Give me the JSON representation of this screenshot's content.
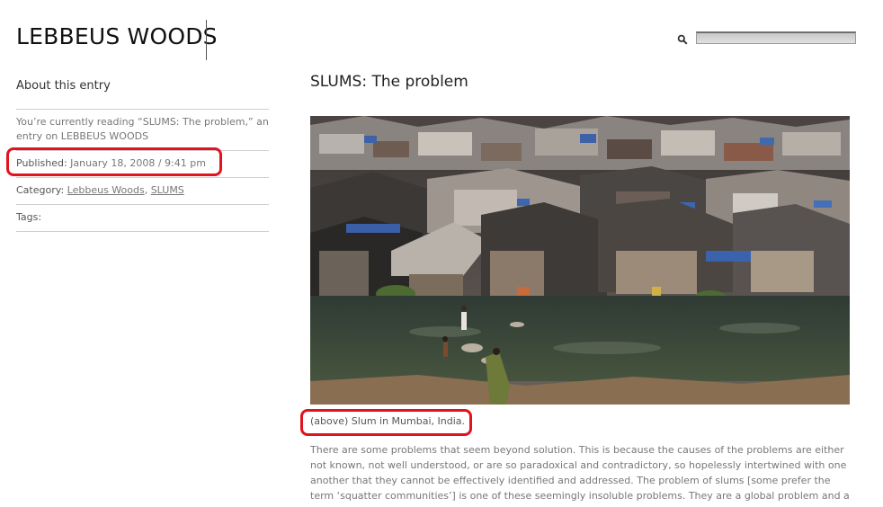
{
  "site": {
    "title": "LEBBEUS WOODS"
  },
  "search": {
    "placeholder": ""
  },
  "sidebar": {
    "heading": "About this entry",
    "reading_text": "You’re currently reading “SLUMS: The problem,” an entry on LEBBEUS WOODS",
    "published_label": "Published:",
    "published_value": "January 18, 2008 / 9:41 pm",
    "category_label": "Category:",
    "categories": [
      "Lebbeus Woods",
      "SLUMS"
    ],
    "category_separator": ", ",
    "tags_label": "Tags:"
  },
  "post": {
    "title": "SLUMS: The problem",
    "caption": "(above) Slum in Mumbai, India.",
    "paragraph": "There are some problems that seem beyond solution. This is because the causes of the problems are either not known, not well understood, or are so paradoxical and contradictory, so hopelessly intertwined with one another that they cannot be effectively identified and addressed. The problem of slums [some prefer the term ‘squatter communities’] is one of these seemingly insoluble problems. They are a global problem and a growing one, as"
  },
  "annotations": {
    "color": "#e0131f"
  }
}
